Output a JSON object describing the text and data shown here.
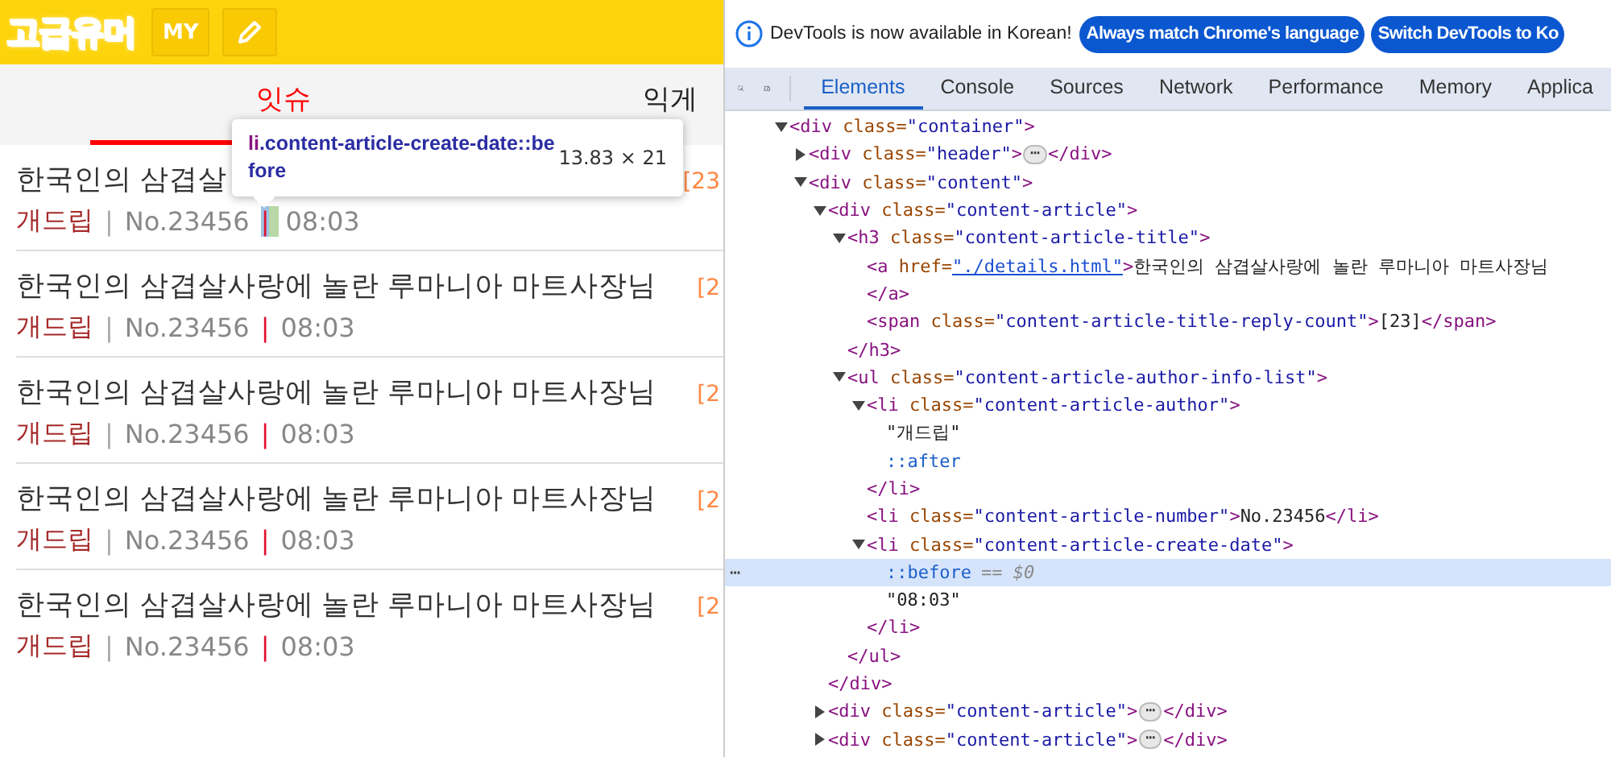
{
  "header": {
    "logo": "고급유머",
    "my_button": "MY"
  },
  "tabs": [
    {
      "label": "잇슈",
      "selected": true
    },
    {
      "label": "익게",
      "selected": false
    }
  ],
  "articles": [
    {
      "title": "한국인의 삼겹살",
      "reply_count": "[23",
      "author": "개드립",
      "separator_1": "|",
      "number": "No.23456",
      "separator_2": "|",
      "time": "08:03",
      "highlighted": true
    },
    {
      "title": "한국인의 삼겹살사랑에 놀란 루마니아 마트사장님",
      "reply_count": "[2",
      "author": "개드립",
      "separator_1": "|",
      "number": "No.23456",
      "separator_2": "|",
      "time": "08:03",
      "highlighted": false
    },
    {
      "title": "한국인의 삼겹살사랑에 놀란 루마니아 마트사장님",
      "reply_count": "[2",
      "author": "개드립",
      "separator_1": "|",
      "number": "No.23456",
      "separator_2": "|",
      "time": "08:03",
      "highlighted": false
    },
    {
      "title": "한국인의 삼겹살사랑에 놀란 루마니아 마트사장님",
      "reply_count": "[2",
      "author": "개드립",
      "separator_1": "|",
      "number": "No.23456",
      "separator_2": "|",
      "time": "08:03",
      "highlighted": false
    },
    {
      "title": "한국인의 삼겹살사랑에 놀란 루마니아 마트사장님",
      "reply_count": "[2",
      "author": "개드립",
      "separator_1": "|",
      "number": "No.23456",
      "separator_2": "|",
      "time": "08:03",
      "highlighted": false
    }
  ],
  "tooltip": {
    "tag": "li",
    "selector": ".content-article-create-date::before",
    "size": "13.83 × 21"
  },
  "devtools": {
    "banner": {
      "message": "DevTools is now available in Korean!",
      "buttons": [
        "Always match Chrome's language",
        "Switch DevTools to Ko"
      ]
    },
    "tabs": [
      {
        "label": "Elements",
        "selected": true
      },
      {
        "label": "Console",
        "selected": false
      },
      {
        "label": "Sources",
        "selected": false
      },
      {
        "label": "Network",
        "selected": false
      },
      {
        "label": "Performance",
        "selected": false
      },
      {
        "label": "Memory",
        "selected": false
      },
      {
        "label": "Applica",
        "selected": false
      }
    ],
    "dom_tree": [
      {
        "kind": "element",
        "open": "<div class=\"container\">",
        "expanded": true,
        "selected": false,
        "children": [
          {
            "kind": "element",
            "open": "<div class=\"header\">",
            "expanded": false,
            "selected": false,
            "ellipsis": "⋯",
            "close": "</div>"
          },
          {
            "kind": "element",
            "open": "<div class=\"content\">",
            "expanded": true,
            "selected": false,
            "children": [
              {
                "kind": "element",
                "open": "<div class=\"content-article\">",
                "expanded": true,
                "selected": false,
                "close": "</div>",
                "children": [
                  {
                    "kind": "element",
                    "open": "<h3 class=\"content-article-title\">",
                    "expanded": true,
                    "selected": false,
                    "close": "</h3>",
                    "children": [
                      {
                        "kind": "element",
                        "open": "<a href=\"./details.html\">",
                        "link": true,
                        "inline_text": "한국인의 삼겹살사랑에 놀란 루마니아 마트사장님",
                        "selected": false,
                        "close": "</a>"
                      },
                      {
                        "kind": "element",
                        "open": "<span class=\"content-article-title-reply-count\">",
                        "inline_text": "[23]",
                        "close_inline": true,
                        "selected": false,
                        "close": "</span>"
                      }
                    ]
                  },
                  {
                    "kind": "element",
                    "open": "<ul class=\"content-article-author-info-list\">",
                    "expanded": true,
                    "selected": false,
                    "close": "</ul>",
                    "children": [
                      {
                        "kind": "element",
                        "open": "<li class=\"content-article-author\">",
                        "expanded": true,
                        "selected": false,
                        "close": "</li>",
                        "children": [
                          {
                            "kind": "text",
                            "text": "\"개드립\"",
                            "selected": false
                          },
                          {
                            "kind": "pseudo",
                            "text": "::after",
                            "selected": false
                          }
                        ]
                      },
                      {
                        "kind": "element",
                        "open": "<li class=\"content-article-number\">",
                        "inline_text": "No.23456",
                        "close_inline": true,
                        "selected": false,
                        "close": "</li>"
                      },
                      {
                        "kind": "element",
                        "open": "<li class=\"content-article-create-date\">",
                        "expanded": true,
                        "selected": false,
                        "close": "</li>",
                        "children": [
                          {
                            "kind": "pseudo",
                            "text": "::before",
                            "suffix": "== $0",
                            "menu": "⋯",
                            "selected": true
                          },
                          {
                            "kind": "text",
                            "text": "\"08:03\"",
                            "selected": false
                          }
                        ]
                      }
                    ]
                  }
                ]
              },
              {
                "kind": "element",
                "open": "<div class=\"content-article\">",
                "expanded": false,
                "selected": false,
                "ellipsis": "⋯",
                "close": "</div>"
              },
              {
                "kind": "element",
                "open": "<div class=\"content-article\">",
                "expanded": false,
                "selected": false,
                "ellipsis": "⋯",
                "close": "</div>"
              }
            ]
          }
        ]
      }
    ]
  }
}
